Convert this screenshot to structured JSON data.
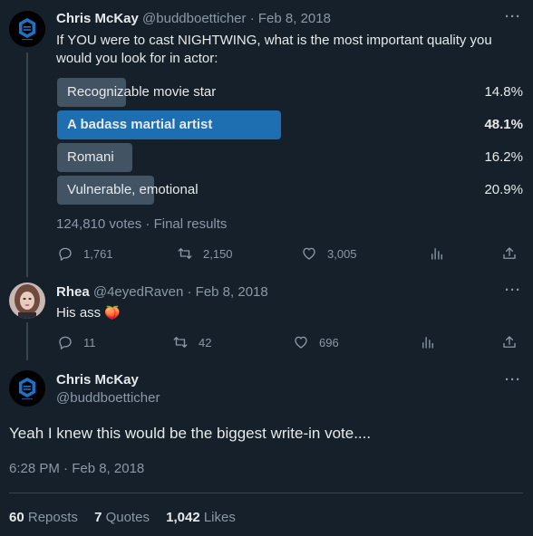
{
  "colors": {
    "background": "#15202b",
    "text": "#e7e9ea",
    "muted": "#8b98a5",
    "poll_bar": "#425364",
    "poll_winner": "#1d6fb2",
    "peach": "#f59a6b"
  },
  "tweet1": {
    "name": "Chris McKay",
    "handle": "@buddboetticher",
    "sep": "·",
    "date": "Feb 8, 2018",
    "text_line1": "If YOU were to cast NIGHTWING, what is the most important quality you",
    "text_line2": "would you look for in actor:",
    "poll": {
      "options": [
        {
          "label": "Recognizable movie star",
          "percent_text": "14.8%",
          "percent": 14.8,
          "winner": false
        },
        {
          "label": "A badass martial artist",
          "percent_text": "48.1%",
          "percent": 48.1,
          "winner": true
        },
        {
          "label": "Romani",
          "percent_text": "16.2%",
          "percent": 16.2,
          "winner": false
        },
        {
          "label": "Vulnerable, emotional",
          "percent_text": "20.9%",
          "percent": 20.9,
          "winner": false
        }
      ],
      "footer": "124,810 votes · Final results"
    },
    "actions": {
      "replies": "1,761",
      "reposts": "2,150",
      "likes": "3,005"
    }
  },
  "tweet2": {
    "name": "Rhea",
    "handle": "@4eyedRaven",
    "sep": "·",
    "date": "Feb 8, 2018",
    "text": "His ass",
    "emoji": "🍑",
    "actions": {
      "replies": "11",
      "reposts": "42",
      "likes": "696"
    }
  },
  "tweet3": {
    "name": "Chris McKay",
    "handle": "@buddboetticher",
    "text": "Yeah I knew this would be the biggest write-in vote....",
    "timestamp": "6:28 PM · Feb 8, 2018",
    "stats": {
      "reposts_num": "60",
      "reposts_label": "Reposts",
      "quotes_num": "7",
      "quotes_label": "Quotes",
      "likes_num": "1,042",
      "likes_label": "Likes"
    }
  },
  "icons": {
    "more": "more-icon",
    "reply": "reply-icon",
    "repost": "repost-icon",
    "like": "heart-icon",
    "views": "views-icon",
    "share": "share-icon"
  }
}
